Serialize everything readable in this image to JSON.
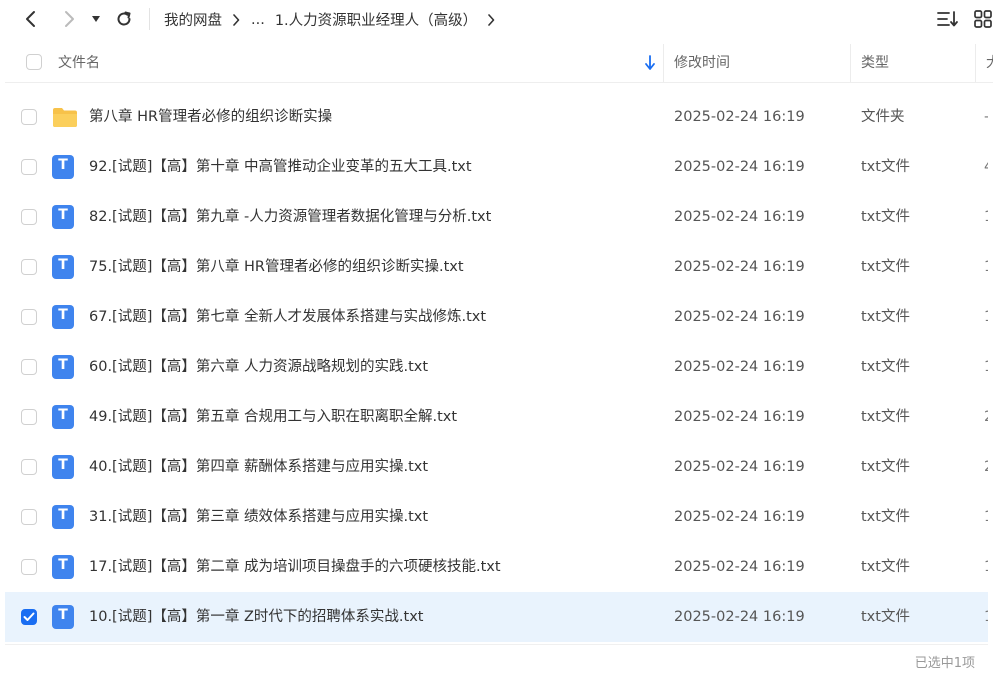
{
  "breadcrumb": {
    "root": "我的网盘",
    "ellipsis": "...",
    "current": "1.人力资源职业经理人（高级）"
  },
  "columns": {
    "name": "文件名",
    "modified": "修改时间",
    "type": "类型",
    "size": "大"
  },
  "files": [
    {
      "name": "第八章 HR管理者必修的组织诊断实操",
      "date": "2025-02-24 16:19",
      "type": "文件夹",
      "size": "-",
      "icon": "folder-icon",
      "selected": false
    },
    {
      "name": "92.[试题]【高】第十章  中高管推动企业变革的五大工具.txt",
      "date": "2025-02-24 16:19",
      "type": "txt文件",
      "size": "4",
      "icon": "txt-file-icon",
      "selected": false
    },
    {
      "name": "82.[试题]【高】第九章 -人力资源管理者数据化管理与分析.txt",
      "date": "2025-02-24 16:19",
      "type": "txt文件",
      "size": "1",
      "icon": "txt-file-icon",
      "selected": false
    },
    {
      "name": "75.[试题]【高】第八章  HR管理者必修的组织诊断实操.txt",
      "date": "2025-02-24 16:19",
      "type": "txt文件",
      "size": "1",
      "icon": "txt-file-icon",
      "selected": false
    },
    {
      "name": "67.[试题]【高】第七章 全新人才发展体系搭建与实战修炼.txt",
      "date": "2025-02-24 16:19",
      "type": "txt文件",
      "size": "1",
      "icon": "txt-file-icon",
      "selected": false
    },
    {
      "name": "60.[试题]【高】第六章 人力资源战略规划的实践.txt",
      "date": "2025-02-24 16:19",
      "type": "txt文件",
      "size": "1",
      "icon": "txt-file-icon",
      "selected": false
    },
    {
      "name": "49.[试题]【高】第五章 合规用工与入职在职离职全解.txt",
      "date": "2025-02-24 16:19",
      "type": "txt文件",
      "size": "2",
      "icon": "txt-file-icon",
      "selected": false
    },
    {
      "name": "40.[试题]【高】第四章 薪酬体系搭建与应用实操.txt",
      "date": "2025-02-24 16:19",
      "type": "txt文件",
      "size": "2",
      "icon": "txt-file-icon",
      "selected": false
    },
    {
      "name": "31.[试题]【高】第三章 绩效体系搭建与应用实操.txt",
      "date": "2025-02-24 16:19",
      "type": "txt文件",
      "size": "1",
      "icon": "txt-file-icon",
      "selected": false
    },
    {
      "name": "17.[试题]【高】第二章  成为培训项目操盘手的六项硬核技能.txt",
      "date": "2025-02-24 16:19",
      "type": "txt文件",
      "size": "1",
      "icon": "txt-file-icon",
      "selected": false
    },
    {
      "name": "10.[试题]【高】第一章  Z时代下的招聘体系实战.txt",
      "date": "2025-02-24 16:19",
      "type": "txt文件",
      "size": "1",
      "icon": "txt-file-icon",
      "selected": true
    }
  ],
  "status": {
    "selection": "已选中1项"
  },
  "colors": {
    "accent": "#1a6ef2",
    "selected_row": "#e9f3fd",
    "txt_icon": "#3f84ee",
    "folder": "#f7c24a"
  }
}
